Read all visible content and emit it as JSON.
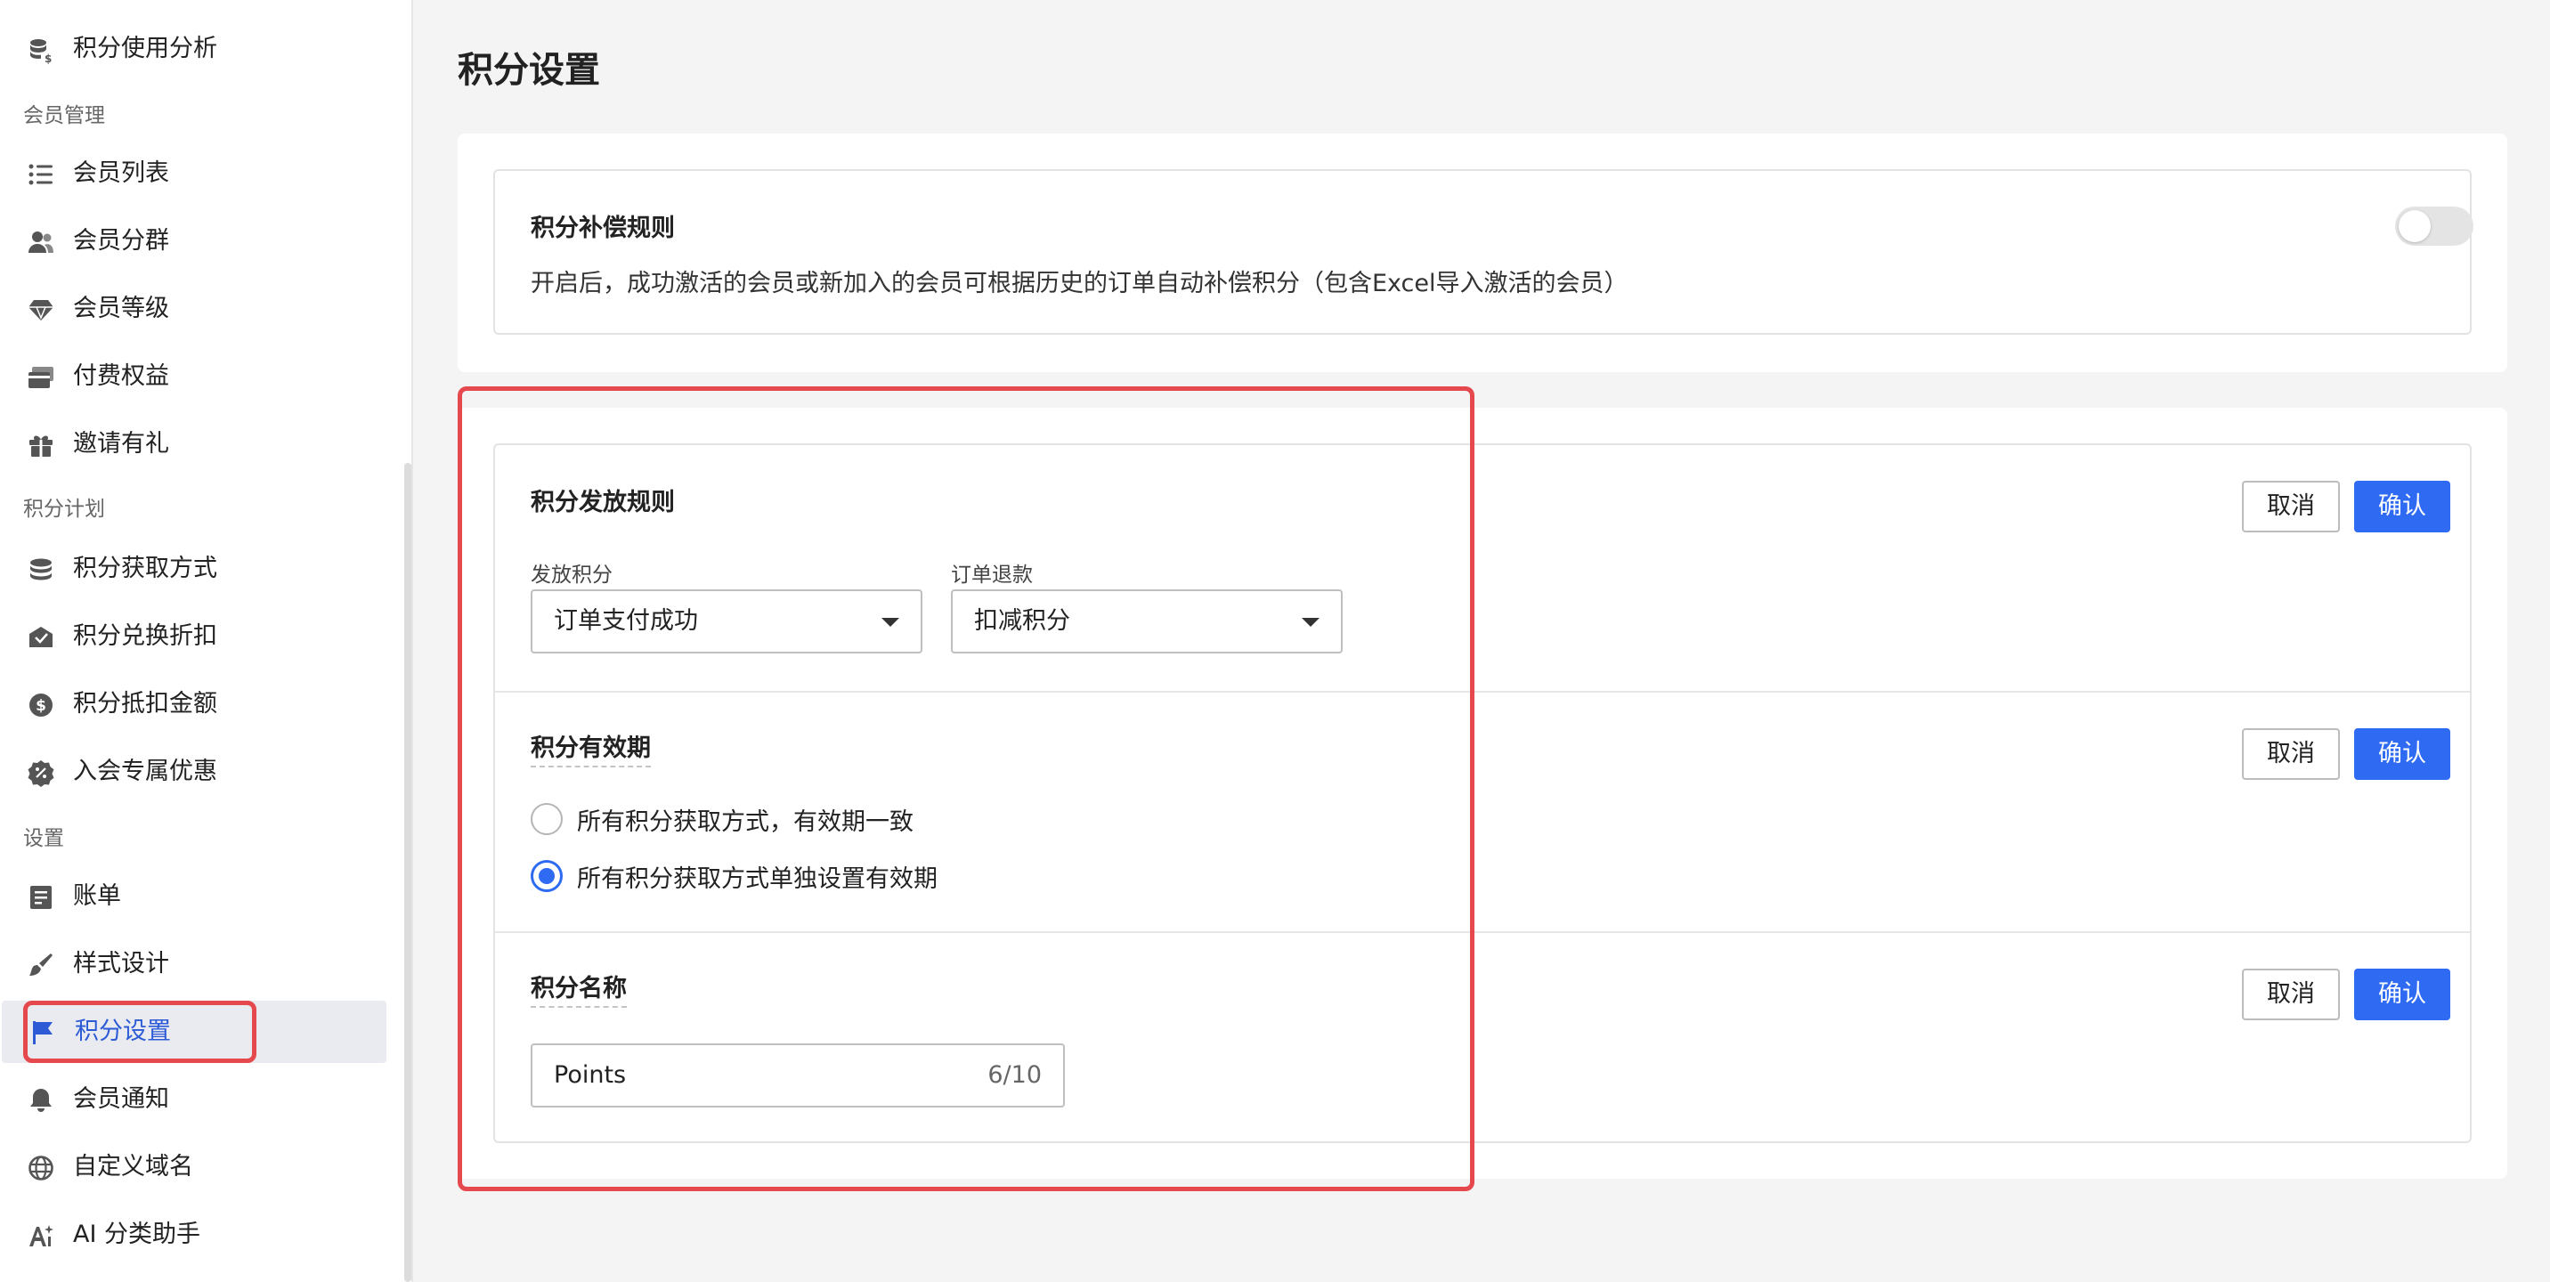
{
  "sidebar": {
    "items_top": [
      {
        "label": "积分使用分析",
        "icon": "database-dollar-icon"
      }
    ],
    "groups": [
      {
        "title": "会员管理",
        "items": [
          {
            "label": "会员列表",
            "icon": "list-icon"
          },
          {
            "label": "会员分群",
            "icon": "users-icon"
          },
          {
            "label": "会员等级",
            "icon": "diamond-icon"
          },
          {
            "label": "付费权益",
            "icon": "card-icon"
          },
          {
            "label": "邀请有礼",
            "icon": "gift-icon"
          }
        ]
      },
      {
        "title": "积分计划",
        "items": [
          {
            "label": "积分获取方式",
            "icon": "coins-icon"
          },
          {
            "label": "积分兑换折扣",
            "icon": "envelope-check-icon"
          },
          {
            "label": "积分抵扣金额",
            "icon": "dollar-circle-icon"
          },
          {
            "label": "入会专属优惠",
            "icon": "percent-badge-icon"
          }
        ]
      },
      {
        "title": "设置",
        "items": [
          {
            "label": "账单",
            "icon": "bill-icon"
          },
          {
            "label": "样式设计",
            "icon": "brush-icon"
          },
          {
            "label": "积分设置",
            "icon": "flag-icon",
            "active": true
          },
          {
            "label": "会员通知",
            "icon": "bell-icon"
          },
          {
            "label": "自定义域名",
            "icon": "globe-icon"
          },
          {
            "label": "AI 分类助手",
            "icon": "ai-sparkle-icon"
          }
        ]
      }
    ]
  },
  "page": {
    "title": "积分设置"
  },
  "compensation": {
    "title": "积分补偿规则",
    "description": "开启后，成功激活的会员或新加入的会员可根据历史的订单自动补偿积分（包含Excel导入激活的会员）",
    "enabled": false
  },
  "issue_rule": {
    "title": "积分发放规则",
    "issue_label": "发放积分",
    "issue_value": "订单支付成功",
    "refund_label": "订单退款",
    "refund_value": "扣减积分"
  },
  "validity": {
    "title": "积分有效期",
    "options": [
      {
        "label": "所有积分获取方式，有效期一致",
        "checked": false
      },
      {
        "label": "所有积分获取方式单独设置有效期",
        "checked": true
      }
    ]
  },
  "points_name": {
    "title": "积分名称",
    "value": "Points",
    "counter": "6/10"
  },
  "buttons": {
    "cancel": "取消",
    "confirm": "确认"
  },
  "colors": {
    "accent": "#2f6bf2",
    "highlight": "#e5484d",
    "active_bg": "#e9ebf1"
  }
}
